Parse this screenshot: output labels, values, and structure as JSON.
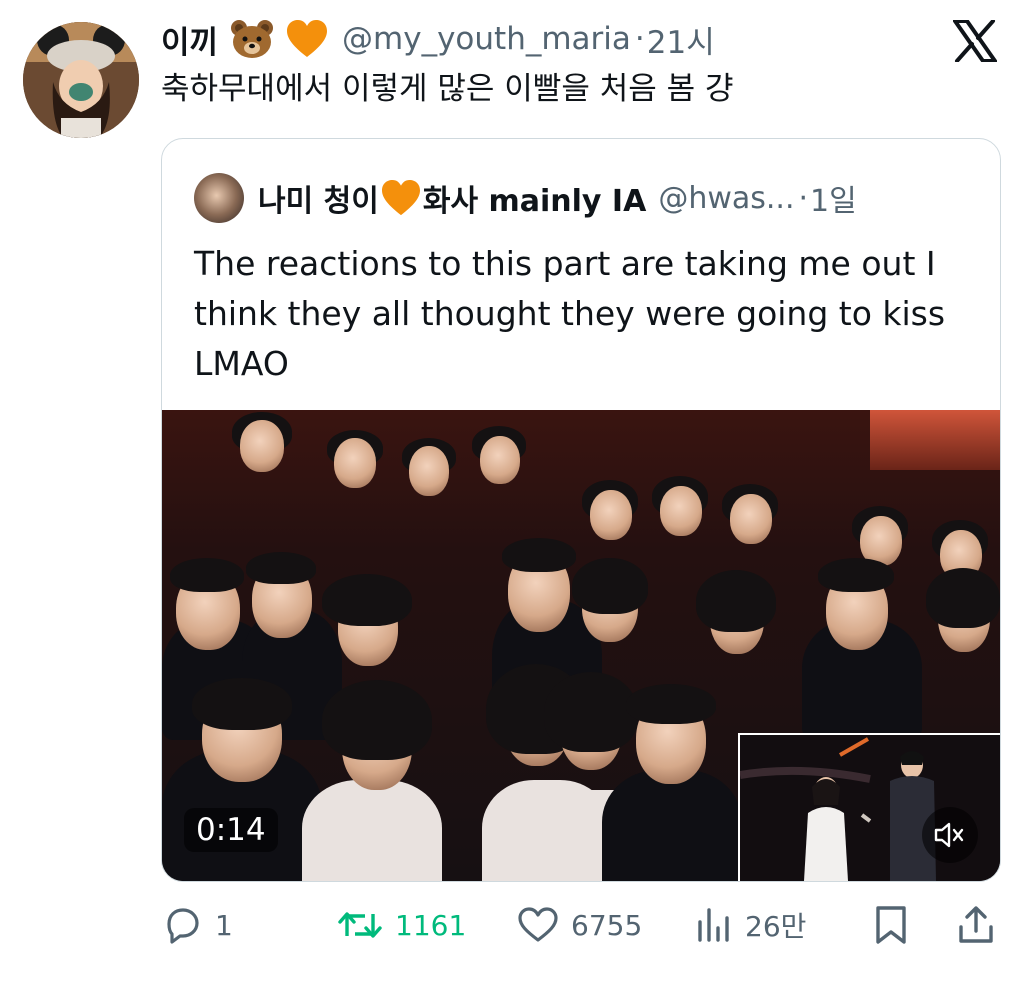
{
  "tweet": {
    "author_name": "이끼",
    "handle": "@my_youth_maria",
    "separator": "·",
    "time": "21시",
    "text": "축하무대에서 이렇게 많은 이빨을 처음 봄 걍"
  },
  "quote": {
    "author_name_prefix": "나미 청이",
    "author_name_suffix": "화사 mainly IA",
    "handle": "@hwas...",
    "separator": "·",
    "time": "1일",
    "text": "The reactions to this part are taking me out I think they all thought they were going to kiss LMAO",
    "video_duration": "0:14"
  },
  "actions": {
    "replies": "1",
    "retweets": "1161",
    "likes": "6755",
    "views": "26만"
  },
  "colors": {
    "text_primary": "#0f1419",
    "text_secondary": "#536471",
    "retweet_green": "#00ba7c",
    "border": "#cfd9de",
    "heart_orange": "#f4900c"
  },
  "icons": [
    "bear-emoji-icon",
    "orange-heart-icon",
    "x-logo-icon",
    "reply-icon",
    "retweet-icon",
    "like-icon",
    "views-icon",
    "bookmark-icon",
    "share-icon",
    "mute-icon"
  ]
}
